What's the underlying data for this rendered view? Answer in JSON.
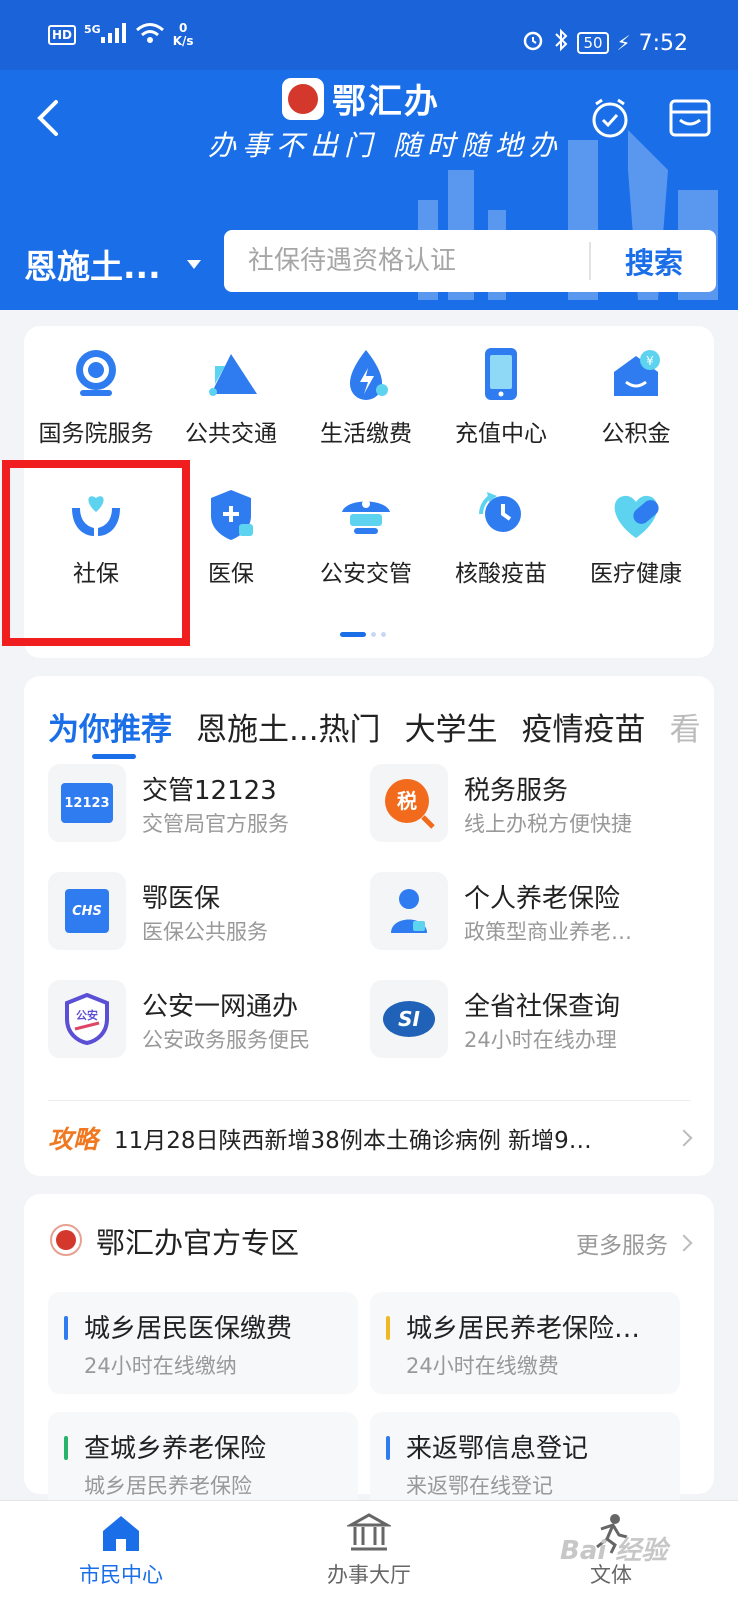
{
  "status_bar": {
    "network": "HD",
    "signal": "5G",
    "speed_value": "0",
    "speed_unit": "K/s",
    "battery": "50",
    "time": "7:52"
  },
  "header": {
    "app_name": "鄂汇办",
    "slogan": "办事不出门 随时随地办",
    "city": "恩施土...",
    "search_placeholder": "社保待遇资格认证",
    "search_button": "搜索"
  },
  "grid": {
    "items": [
      {
        "label": "国务院服务",
        "icon": "state-council-icon"
      },
      {
        "label": "公共交通",
        "icon": "transit-icon"
      },
      {
        "label": "生活缴费",
        "icon": "utility-icon"
      },
      {
        "label": "充值中心",
        "icon": "phone-recharge-icon"
      },
      {
        "label": "公积金",
        "icon": "housing-fund-icon"
      },
      {
        "label": "社保",
        "icon": "social-security-icon"
      },
      {
        "label": "医保",
        "icon": "medical-insurance-icon"
      },
      {
        "label": "公安交管",
        "icon": "police-traffic-icon"
      },
      {
        "label": "核酸疫苗",
        "icon": "nucleic-vaccine-icon"
      },
      {
        "label": "医疗健康",
        "icon": "health-icon"
      }
    ],
    "page_indicator": {
      "current": 1,
      "total": 3
    },
    "highlight_color": "#f01e1e"
  },
  "recommend": {
    "tabs": [
      "为你推荐",
      "恩施土...热门",
      "大学生",
      "疫情疫苗",
      "看"
    ],
    "services": [
      {
        "title": "交管12123",
        "subtitle": "交管局官方服务",
        "icon_text": "12123"
      },
      {
        "title": "税务服务",
        "subtitle": "线上办税方便快捷",
        "icon_text": "税"
      },
      {
        "title": "鄂医保",
        "subtitle": "医保公共服务",
        "icon_text": "CHS"
      },
      {
        "title": "个人养老保险",
        "subtitle": "政策型商业养老…",
        "icon_text": ""
      },
      {
        "title": "公安一网通办",
        "subtitle": "公安政务服务便民",
        "icon_text": "公安"
      },
      {
        "title": "全省社保查询",
        "subtitle": "24小时在线办理",
        "icon_text": "SI"
      }
    ],
    "news_tag": "攻略",
    "news_text": "11月28日陕西新增38例本土确诊病例 新增9…"
  },
  "official": {
    "title": "鄂汇办官方专区",
    "more": "更多服务",
    "tiles": [
      {
        "title": "城乡居民医保缴费",
        "subtitle": "24小时在线缴纳",
        "color": "#2f7bf0"
      },
      {
        "title": "城乡居民养老保险…",
        "subtitle": "24小时在线缴费",
        "color": "#f2b824"
      },
      {
        "title": "查城乡养老保险",
        "subtitle": "城乡居民养老保险",
        "color": "#27b36a"
      },
      {
        "title": "来返鄂信息登记",
        "subtitle": "来返鄂在线登记",
        "color": "#2f7bf0"
      }
    ]
  },
  "bottom_nav": [
    {
      "label": "市民中心",
      "active": true
    },
    {
      "label": "办事大厅",
      "active": false
    },
    {
      "label": "文体",
      "active": false
    }
  ],
  "watermark": "Bai 经验"
}
